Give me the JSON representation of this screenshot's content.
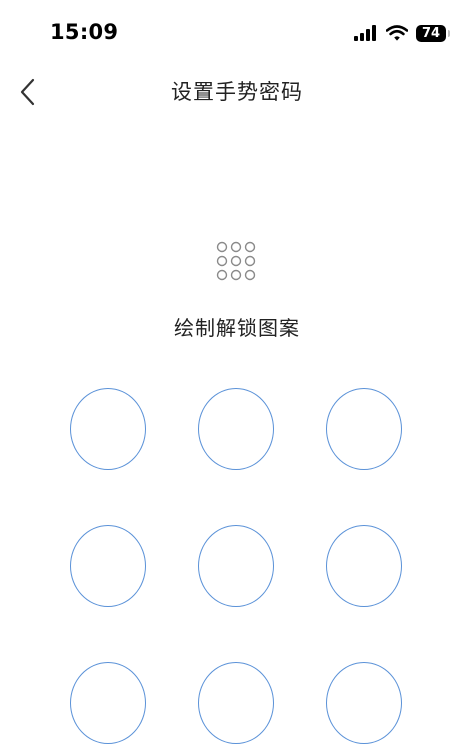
{
  "status_bar": {
    "time": "15:09",
    "battery_level": "74"
  },
  "header": {
    "title": "设置手势密码"
  },
  "prompt": {
    "text": "绘制解锁图案"
  },
  "pattern_grid": {
    "rows": 3,
    "columns": 3,
    "selected_nodes": []
  },
  "colors": {
    "node_stroke": "#5b92d8",
    "preview_dot": "#8a8a8a",
    "text": "#222222"
  },
  "icons": {
    "back": "chevron-left-icon",
    "preview": "pattern-dots-icon"
  }
}
